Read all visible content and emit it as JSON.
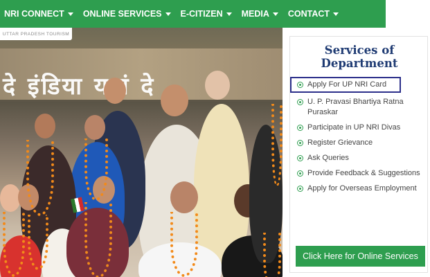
{
  "nav": {
    "items": [
      {
        "label": "NRI CONNECT"
      },
      {
        "label": "ONLINE SERVICES"
      },
      {
        "label": "E-CITIZEN"
      },
      {
        "label": "MEDIA"
      },
      {
        "label": "CONTACT"
      }
    ],
    "color": "#2e9e4f"
  },
  "hero": {
    "banner_text": "दे इंडिया यहां दे",
    "stamp_text": "UTTAR PRADESH TOURISM"
  },
  "services": {
    "title_line1": "Services of",
    "title_line2": "Department",
    "items": [
      {
        "label": "Apply For UP NRI Card",
        "highlighted": true
      },
      {
        "label": "U. P. Pravasi Bhartiya Ratna Puraskar"
      },
      {
        "label": "Participate in UP NRI Divas"
      },
      {
        "label": "Register Grievance"
      },
      {
        "label": "Ask Queries"
      },
      {
        "label": "Provide Feedback & Suggestions"
      },
      {
        "label": "Apply for Overseas Employment"
      }
    ],
    "cta_label": "Click Here for Online Services",
    "title_color": "#1f3b73",
    "highlight_color": "#2c2f8a"
  }
}
